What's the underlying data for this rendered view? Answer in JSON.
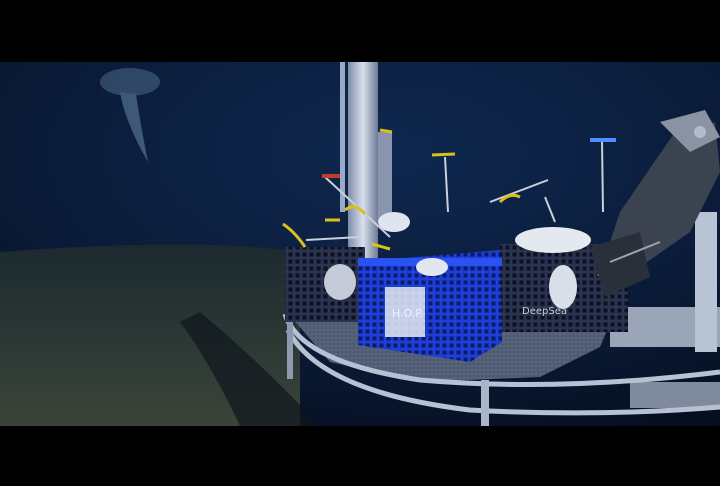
{
  "image": {
    "crate_label": "H.O.P.",
    "crate_side_text": "DeepSea",
    "colors": {
      "water": "#0a1e3a",
      "sediment": "#2e3a34",
      "platform": "#8a97a8",
      "crate_blue": "#1d3fd6",
      "crate_dark": "#1a2238",
      "yellow_handle": "#d8c21a"
    }
  }
}
